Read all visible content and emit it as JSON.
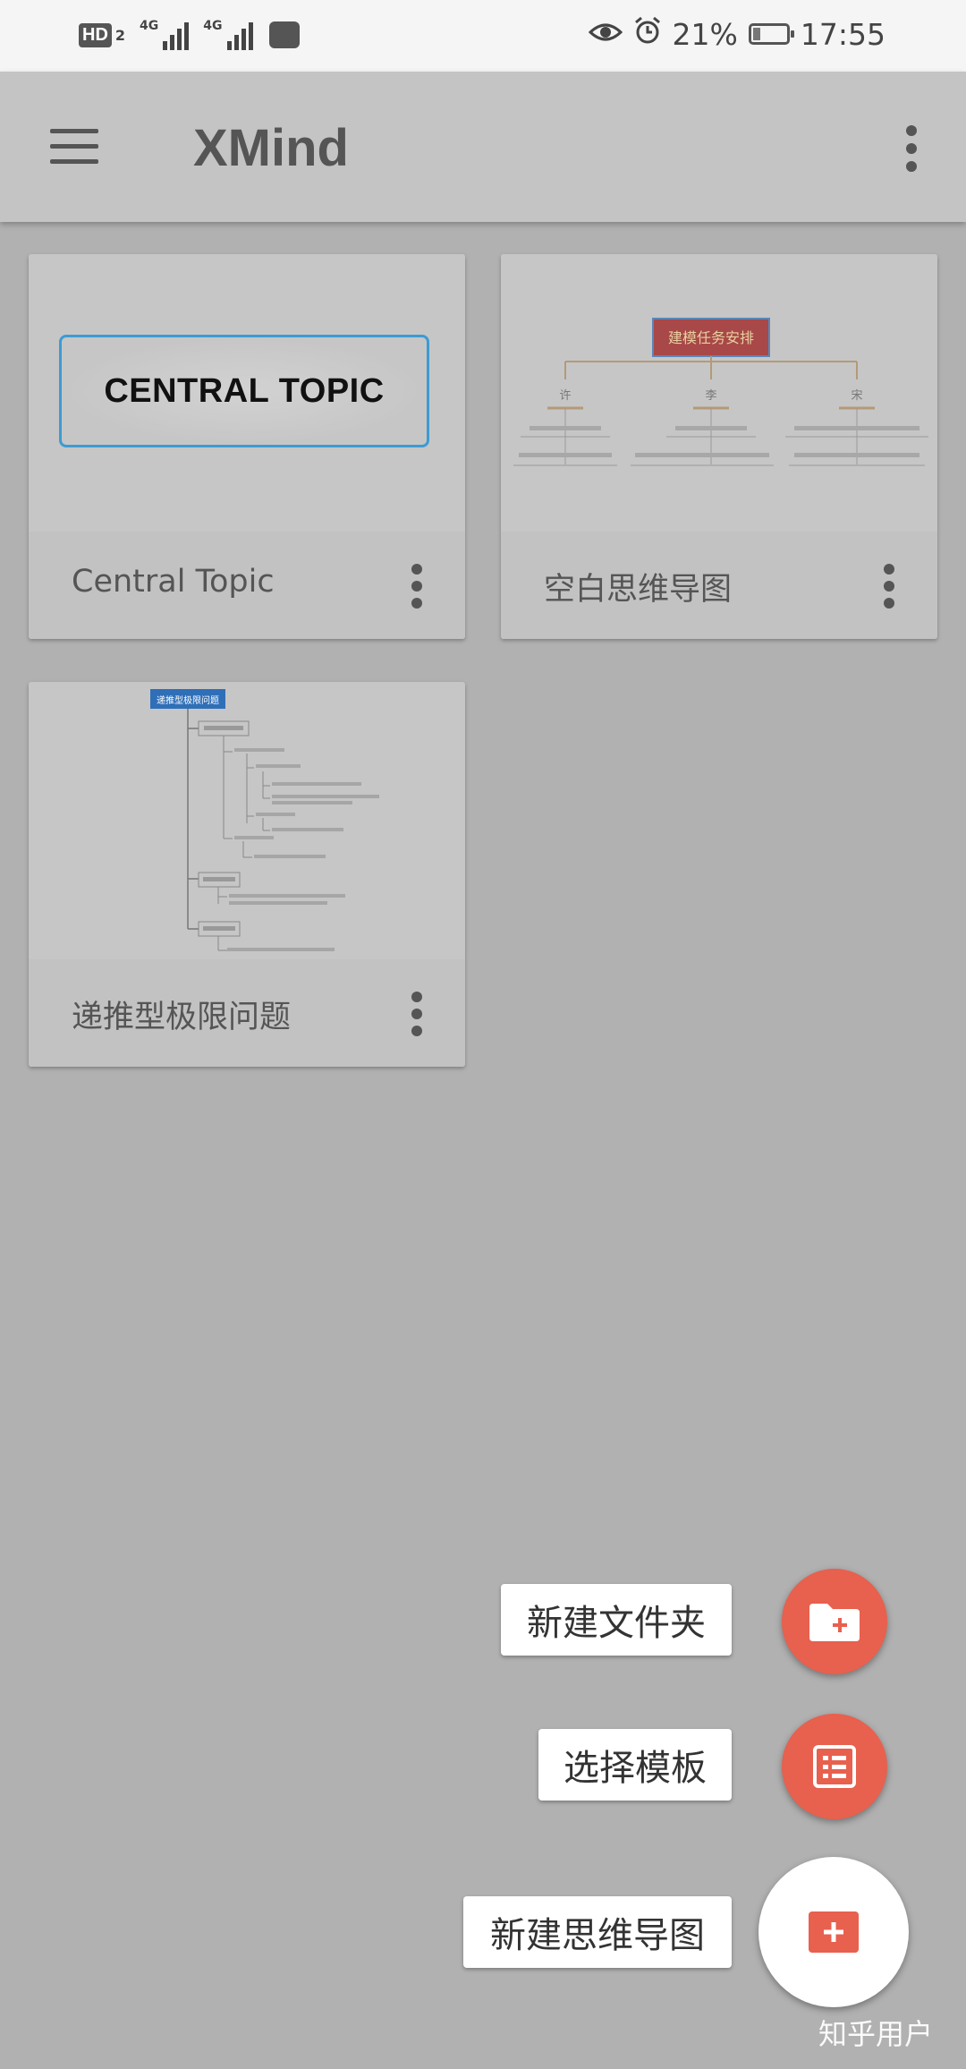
{
  "status_bar": {
    "hd_label": "HD",
    "hd_sub": "2",
    "network1": "4G",
    "network2": "4G",
    "battery_percent": "21%",
    "battery_level": 0.21,
    "time": "17:55"
  },
  "app_bar": {
    "title": "XMind"
  },
  "cards": [
    {
      "title": "Central Topic",
      "preview_text": "CENTRAL TOPIC"
    },
    {
      "title": "空白思维导图",
      "preview_root": "建模任务安排",
      "preview_branches": [
        "许",
        "李",
        "宋"
      ]
    },
    {
      "title": "递推型极限问题",
      "preview_root": "递推型极限问题"
    }
  ],
  "fab_menu": {
    "new_folder": "新建文件夹",
    "choose_template": "选择模板",
    "new_mindmap": "新建思维导图"
  },
  "watermark": "知乎用户",
  "colors": {
    "accent": "#e8604e",
    "topic_border": "#3d9bd3",
    "preview_root_fill": "#a84848"
  }
}
